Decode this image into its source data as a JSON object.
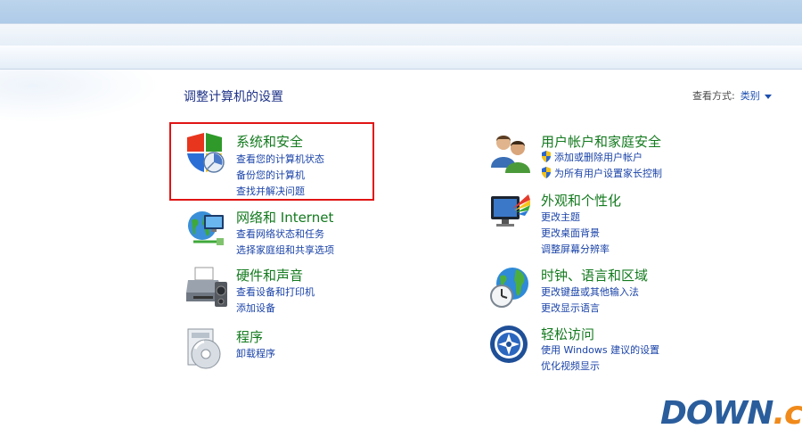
{
  "page": {
    "title": "调整计算机的设置",
    "view_by_label": "查看方式:",
    "view_by_value": "类别"
  },
  "categories": [
    {
      "title": "系统和安全",
      "icon": "shield-icon",
      "links": [
        "查看您的计算机状态",
        "备份您的计算机",
        "查找并解决问题"
      ]
    },
    {
      "title": "网络和 Internet",
      "icon": "network-globe-icon",
      "links": [
        "查看网络状态和任务",
        "选择家庭组和共享选项"
      ]
    },
    {
      "title": "硬件和声音",
      "icon": "printer-icon",
      "links": [
        "查看设备和打印机",
        "添加设备"
      ]
    },
    {
      "title": "程序",
      "icon": "programs-disc-icon",
      "links": [
        "卸载程序"
      ]
    },
    {
      "title": "用户帐户和家庭安全",
      "icon": "users-icon",
      "links": [
        "添加或删除用户帐户",
        "为所有用户设置家长控制"
      ]
    },
    {
      "title": "外观和个性化",
      "icon": "monitor-color-icon",
      "links": [
        "更改主题",
        "更改桌面背景",
        "调整屏幕分辨率"
      ]
    },
    {
      "title": "时钟、语言和区域",
      "icon": "clock-globe-icon",
      "links": [
        "更改键盘或其他输入法",
        "更改显示语言"
      ]
    },
    {
      "title": "轻松访问",
      "icon": "ease-of-access-icon",
      "links": [
        "使用 Windows 建议的设置",
        "优化视频显示"
      ]
    }
  ],
  "watermark": {
    "main": "DOWN",
    "suffix": ".cc"
  },
  "colors": {
    "category_title": "#137a1e",
    "link": "#1a43a8",
    "page_title": "#1e3287",
    "highlight_box": "#e01414"
  }
}
